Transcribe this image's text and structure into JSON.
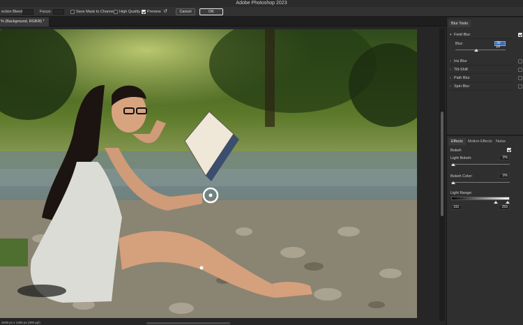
{
  "app": {
    "title": "Adobe Photoshop 2023"
  },
  "options_bar": {
    "selection_bleed_label": "ection Bleed:",
    "focus_label": "Focus:",
    "save_mask_label": "Save Mask to Channels",
    "save_mask_checked": false,
    "high_quality_label": "High Quality",
    "high_quality_checked": false,
    "preview_label": "Preview",
    "preview_checked": true,
    "cancel_label": "Cancel",
    "ok_label": "OK"
  },
  "document": {
    "tab_label": "% (Background, RGB/8) *",
    "status_text": "2048 px x 1365 px (300 ppi)"
  },
  "blur_tools": {
    "tab_label": "Blur Tools",
    "items": [
      {
        "label": "Field Blur",
        "checked": true,
        "expanded": true
      },
      {
        "label": "Iris Blur",
        "checked": false,
        "expanded": false
      },
      {
        "label": "Tilt-Shift",
        "checked": false,
        "expanded": false
      },
      {
        "label": "Path Blur",
        "checked": false,
        "expanded": false
      },
      {
        "label": "Spin Blur",
        "checked": false,
        "expanded": false
      }
    ],
    "blur_label": "Blur:",
    "blur_value": "30 px",
    "blur_fraction": 0.42
  },
  "effects": {
    "tabs": [
      {
        "label": "Effects"
      },
      {
        "label": "Motion Effects"
      },
      {
        "label": "Noise"
      }
    ],
    "bokeh_label": "Bokeh",
    "bokeh_checked": true,
    "light_bokeh_label": "Light Bokeh:",
    "light_bokeh_value": "0%",
    "bokeh_color_label": "Bokeh Color:",
    "bokeh_color_value": "0%",
    "light_range_label": "Light Range:",
    "light_range_low": "191",
    "light_range_high": "255"
  },
  "colors": {
    "accent": "#3a6db3",
    "panel_bg": "#2f2f2f",
    "chrome_bg": "#323232"
  }
}
